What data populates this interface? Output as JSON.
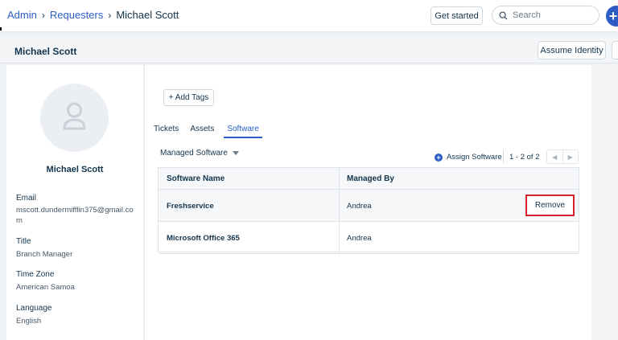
{
  "topbar": {
    "breadcrumb": [
      "Admin",
      "Requesters",
      "Michael Scott"
    ],
    "get_started": "Get started",
    "search_placeholder": "Search",
    "new_button": "+"
  },
  "header": {
    "title": "Michael Scott",
    "assume_identity": "Assume Identity"
  },
  "profile": {
    "name": "Michael Scott",
    "fields": [
      {
        "label": "Email",
        "value": "mscott.dundermifflin375@gmail.com"
      },
      {
        "label": "Title",
        "value": "Branch Manager"
      },
      {
        "label": "Time Zone",
        "value": "American Samoa"
      },
      {
        "label": "Language",
        "value": "English"
      }
    ]
  },
  "main": {
    "add_tags": "+ Add Tags",
    "tabs": [
      {
        "label": "Tickets",
        "active": false
      },
      {
        "label": "Assets",
        "active": false
      },
      {
        "label": "Software",
        "active": true
      }
    ],
    "filter_label": "Managed Software",
    "assign_software": "Assign Software",
    "pagination": "1 - 2 of 2",
    "table": {
      "columns": [
        "Software Name",
        "Managed By"
      ],
      "rows": [
        {
          "name": "Freshservice",
          "managed_by": "Andrea",
          "action": "Remove"
        },
        {
          "name": "Microsoft Office 365",
          "managed_by": "Andrea"
        }
      ]
    }
  },
  "colors": {
    "accent": "#2c5cc5",
    "highlight": "#d7222a"
  }
}
